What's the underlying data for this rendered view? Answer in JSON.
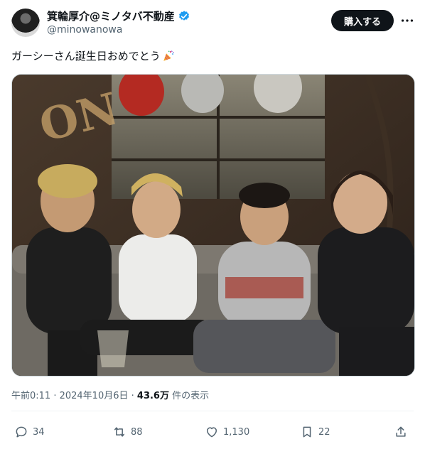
{
  "author": {
    "display_name": "箕輪厚介@ミノタバ不動産",
    "handle": "@minowanowa",
    "verified_icon": "verified-badge-icon"
  },
  "header": {
    "buy_label": "購入する",
    "more_icon": "more-horizontal-icon"
  },
  "post": {
    "text": "ガーシーさん誕生日おめでとう",
    "emoji_icon": "party-popper-icon",
    "image_icon": "photo-four-men-on-couch"
  },
  "meta": {
    "timestamp": "午前0:11 · 2024年10月6日",
    "sep": " · ",
    "views_count": "43.6万",
    "views_label": " 件の表示"
  },
  "actions": {
    "replies": "34",
    "reposts": "88",
    "likes": "1,130",
    "bookmarks": "22"
  },
  "colors": {
    "accent": "#1d9bf0",
    "text": "#0f1419",
    "muted": "#536471"
  }
}
